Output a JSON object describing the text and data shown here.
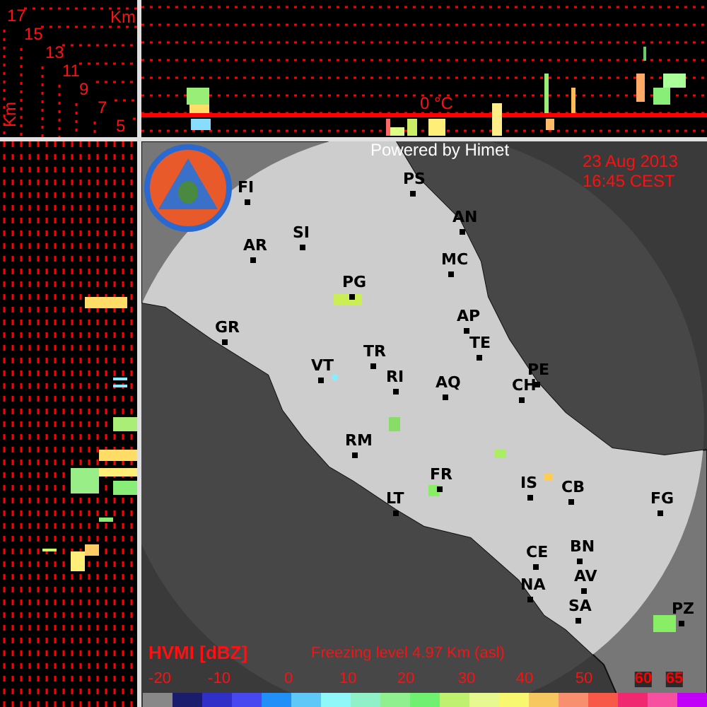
{
  "height_panel": {
    "axis_labels": [
      "17",
      "15",
      "13",
      "11",
      "9",
      "7",
      "5"
    ],
    "unit": "Km",
    "side_unit": "Km"
  },
  "top_section": {
    "freezing_label": "0 °C"
  },
  "map": {
    "credit": "Powered by Himet",
    "date": "23 Aug 2013",
    "time": "16:45 CEST",
    "cities": [
      "FI",
      "PS",
      "AN",
      "SI",
      "AR",
      "MC",
      "PG",
      "GR",
      "AP",
      "TE",
      "TR",
      "RI",
      "VT",
      "AQ",
      "PE",
      "CH",
      "RM",
      "FR",
      "LT",
      "IS",
      "CB",
      "FG",
      "CE",
      "BN",
      "AV",
      "NA",
      "SA",
      "PZ"
    ]
  },
  "legend": {
    "title": "HVMI [dBZ]",
    "freezing_level": "Freezing level  4.97 Km (asl)",
    "ticks": [
      "-20",
      "-10",
      "0",
      "10",
      "20",
      "30",
      "40",
      "50",
      "60",
      "65"
    ]
  }
}
